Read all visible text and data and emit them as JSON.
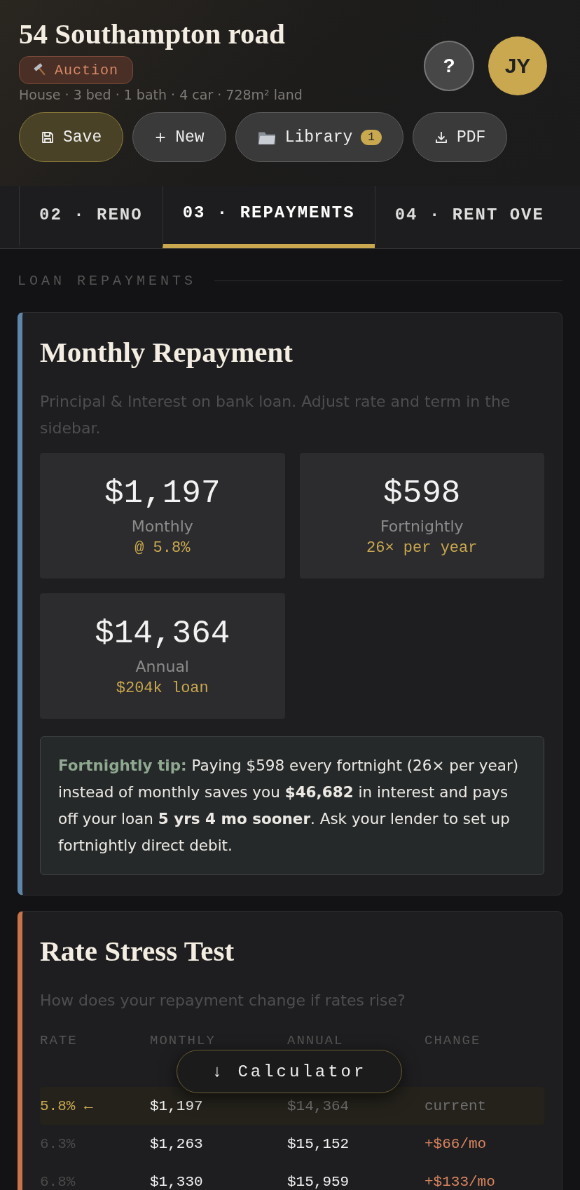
{
  "header": {
    "title": "54 Southampton road",
    "badge": "Auction",
    "meta": "House · 3 bed · 1 bath · 4 car · 728m² land",
    "help": "?",
    "avatar": "JY",
    "actions": [
      {
        "kind": "save",
        "label": "Save"
      },
      {
        "kind": "new",
        "label": "New"
      },
      {
        "kind": "library",
        "label": "Library",
        "count": "1"
      },
      {
        "kind": "pdf",
        "label": "PDF"
      }
    ]
  },
  "tabs": [
    {
      "label": "02 · RENO",
      "selected": false
    },
    {
      "label": "03 · REPAYMENTS",
      "selected": true
    },
    {
      "label": "04 · RENT OVE",
      "selected": false
    }
  ],
  "section_label": "LOAN REPAYMENTS",
  "repayment_card": {
    "title": "Monthly Repayment",
    "color": "#5f86a8",
    "description": "Principal & Interest on bank loan. Adjust rate and term in the sidebar.",
    "stats": [
      {
        "value": "$1,197",
        "label": "Monthly",
        "note": "@ 5.8%"
      },
      {
        "value": "$598",
        "label": "Fortnightly",
        "note": "26× per year"
      },
      {
        "value": "$14,364",
        "label": "Annual",
        "note": "$204k loan"
      }
    ],
    "tip_label": "Fortnightly tip:",
    "tip": "Paying $598 every fortnight (26× per year) instead of monthly saves you **$46,682** in interest and pays off your loan **5 yrs 4 mo sooner**. Ask your lender to set up fortnightly direct debit."
  },
  "stress_card": {
    "title": "Rate Stress Test",
    "color": "#c87348",
    "description": "How does your repayment change if rates rise?",
    "columns": [
      "RATE",
      "MONTHLY",
      "ANNUAL",
      "CHANGE"
    ],
    "rows": [
      {
        "rate": "5.8% ←",
        "monthly": "$1,197",
        "annual": "$14,364",
        "change": "current",
        "current": true
      },
      {
        "rate": "6.3%",
        "monthly": "$1,263",
        "annual": "$15,152",
        "change": "+$66/mo",
        "current": false
      },
      {
        "rate": "6.8%",
        "monthly": "$1,330",
        "annual": "$15,959",
        "change": "+$133/mo",
        "current": false
      }
    ]
  },
  "calculator_button": "↓ Calculator"
}
